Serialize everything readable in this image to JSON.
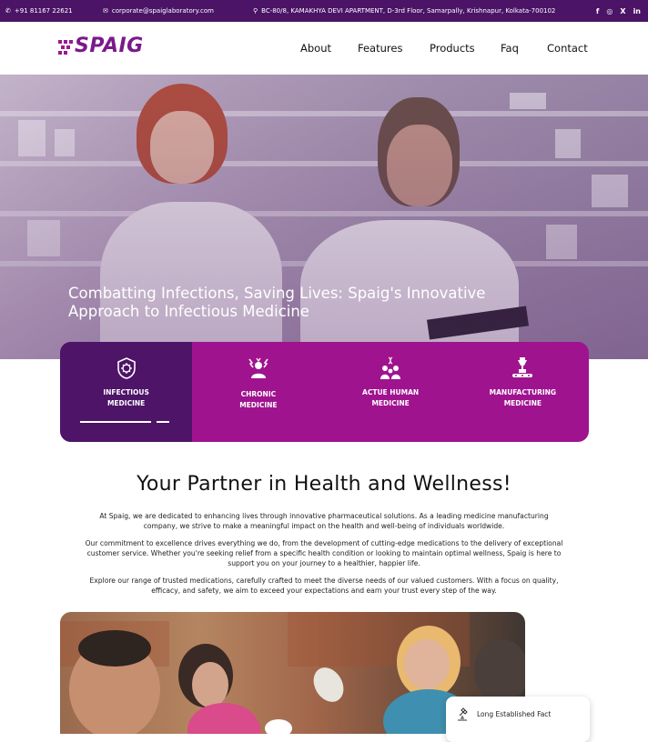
{
  "topbar": {
    "phone": "+91 81167 22621",
    "email": "corporate@spaiglaboratory.com",
    "address": "BC-80/8, KAMAKHYA DEVI APARTMENT, D-3rd Floor, Samarpally, Krishnapur, Kolkata-700102",
    "social": [
      "f",
      "◎",
      "X",
      "in"
    ]
  },
  "brand": {
    "name": "SPAIG",
    "color": "#7a1a8a"
  },
  "nav": {
    "items": [
      "About",
      "Features",
      "Products",
      "Faq",
      "Contact"
    ]
  },
  "hero": {
    "title_line1": "Combatting Infections, Saving Lives: Spaig's Innovative",
    "title_line2": "Approach to Infectious Medicine"
  },
  "categories": [
    {
      "line1": "INFECTIOUS",
      "line2": "MEDICINE",
      "icon": "shield-virus-icon"
    },
    {
      "line1": "CHRONIC",
      "line2": "MEDICINE",
      "icon": "person-pain-icon"
    },
    {
      "line1": "ACTUE HUMAN",
      "line2": "MEDICINE",
      "icon": "family-dna-icon"
    },
    {
      "line1": "MANUFACTURING",
      "line2": "MEDICINE",
      "icon": "machine-icon"
    }
  ],
  "about": {
    "title": "Your Partner in Health and Wellness!",
    "p1": "At Spaig, we are dedicated to enhancing lives through innovative pharmaceutical solutions. As a leading medicine manufacturing company, we strive to make a meaningful impact on the health and well-being of individuals worldwide.",
    "p2": "Our commitment to excellence drives everything we do, from the development of cutting-edge medications to the delivery of exceptional customer service. Whether you're seeking relief from a specific health condition or looking to maintain optimal wellness, Spaig is here to support you on your journey to a healthier, happier life.",
    "p3": "Explore our range of trusted medications, carefully crafted to meet the diverse needs of our valued customers. With a focus on quality, efficacy, and safety, we aim to exceed your expectations and earn your trust every step of the way."
  },
  "feature_card": {
    "label": "Long Established Fact"
  },
  "colors": {
    "topbar": "#4b1466",
    "accent": "#a0138f",
    "active": "#4d1468"
  }
}
